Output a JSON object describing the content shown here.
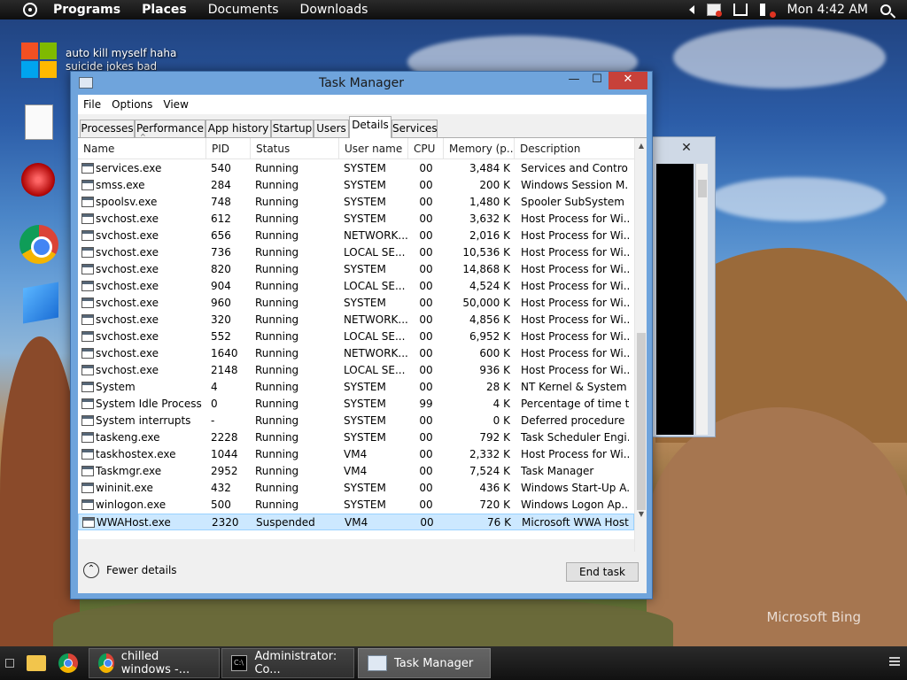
{
  "top_panel": {
    "menus": [
      "Programs",
      "Places",
      "Documents",
      "Downloads"
    ],
    "clock": "Mon 4:42 AM"
  },
  "desktop": {
    "icon_label_1": "auto kill myself haha",
    "icon_label_2": "suicide jokes bad",
    "watermark": "Microsoft Bing"
  },
  "task_manager": {
    "title": "Task Manager",
    "menu": [
      "File",
      "Options",
      "View"
    ],
    "tabs": [
      "Processes",
      "Performance",
      "App history",
      "Startup",
      "Users",
      "Details",
      "Services"
    ],
    "active_tab": "Details",
    "columns": [
      "Name",
      "PID",
      "Status",
      "User name",
      "CPU",
      "Memory (p...",
      "Description"
    ],
    "rows": [
      {
        "name": "services.exe",
        "pid": "540",
        "status": "Running",
        "user": "SYSTEM",
        "cpu": "00",
        "mem": "3,484 K",
        "desc": "Services and Control..."
      },
      {
        "name": "smss.exe",
        "pid": "284",
        "status": "Running",
        "user": "SYSTEM",
        "cpu": "00",
        "mem": "200 K",
        "desc": "Windows Session M..."
      },
      {
        "name": "spoolsv.exe",
        "pid": "748",
        "status": "Running",
        "user": "SYSTEM",
        "cpu": "00",
        "mem": "1,480 K",
        "desc": "Spooler SubSystem ..."
      },
      {
        "name": "svchost.exe",
        "pid": "612",
        "status": "Running",
        "user": "SYSTEM",
        "cpu": "00",
        "mem": "3,632 K",
        "desc": "Host Process for Wi..."
      },
      {
        "name": "svchost.exe",
        "pid": "656",
        "status": "Running",
        "user": "NETWORK...",
        "cpu": "00",
        "mem": "2,016 K",
        "desc": "Host Process for Wi..."
      },
      {
        "name": "svchost.exe",
        "pid": "736",
        "status": "Running",
        "user": "LOCAL SE...",
        "cpu": "00",
        "mem": "10,536 K",
        "desc": "Host Process for Wi..."
      },
      {
        "name": "svchost.exe",
        "pid": "820",
        "status": "Running",
        "user": "SYSTEM",
        "cpu": "00",
        "mem": "14,868 K",
        "desc": "Host Process for Wi..."
      },
      {
        "name": "svchost.exe",
        "pid": "904",
        "status": "Running",
        "user": "LOCAL SE...",
        "cpu": "00",
        "mem": "4,524 K",
        "desc": "Host Process for Wi..."
      },
      {
        "name": "svchost.exe",
        "pid": "960",
        "status": "Running",
        "user": "SYSTEM",
        "cpu": "00",
        "mem": "50,000 K",
        "desc": "Host Process for Wi..."
      },
      {
        "name": "svchost.exe",
        "pid": "320",
        "status": "Running",
        "user": "NETWORK...",
        "cpu": "00",
        "mem": "4,856 K",
        "desc": "Host Process for Wi..."
      },
      {
        "name": "svchost.exe",
        "pid": "552",
        "status": "Running",
        "user": "LOCAL SE...",
        "cpu": "00",
        "mem": "6,952 K",
        "desc": "Host Process for Wi..."
      },
      {
        "name": "svchost.exe",
        "pid": "1640",
        "status": "Running",
        "user": "NETWORK...",
        "cpu": "00",
        "mem": "600 K",
        "desc": "Host Process for Wi..."
      },
      {
        "name": "svchost.exe",
        "pid": "2148",
        "status": "Running",
        "user": "LOCAL SE...",
        "cpu": "00",
        "mem": "936 K",
        "desc": "Host Process for Wi..."
      },
      {
        "name": "System",
        "pid": "4",
        "status": "Running",
        "user": "SYSTEM",
        "cpu": "00",
        "mem": "28 K",
        "desc": "NT Kernel & System"
      },
      {
        "name": "System Idle Process",
        "pid": "0",
        "status": "Running",
        "user": "SYSTEM",
        "cpu": "99",
        "mem": "4 K",
        "desc": "Percentage of time t..."
      },
      {
        "name": "System interrupts",
        "pid": "-",
        "status": "Running",
        "user": "SYSTEM",
        "cpu": "00",
        "mem": "0 K",
        "desc": "Deferred procedure ..."
      },
      {
        "name": "taskeng.exe",
        "pid": "2228",
        "status": "Running",
        "user": "SYSTEM",
        "cpu": "00",
        "mem": "792 K",
        "desc": "Task Scheduler Engi..."
      },
      {
        "name": "taskhostex.exe",
        "pid": "1044",
        "status": "Running",
        "user": "VM4",
        "cpu": "00",
        "mem": "2,332 K",
        "desc": "Host Process for Wi..."
      },
      {
        "name": "Taskmgr.exe",
        "pid": "2952",
        "status": "Running",
        "user": "VM4",
        "cpu": "00",
        "mem": "7,524 K",
        "desc": "Task Manager"
      },
      {
        "name": "wininit.exe",
        "pid": "432",
        "status": "Running",
        "user": "SYSTEM",
        "cpu": "00",
        "mem": "436 K",
        "desc": "Windows Start-Up A..."
      },
      {
        "name": "winlogon.exe",
        "pid": "500",
        "status": "Running",
        "user": "SYSTEM",
        "cpu": "00",
        "mem": "720 K",
        "desc": "Windows Logon Ap..."
      },
      {
        "name": "WWAHost.exe",
        "pid": "2320",
        "status": "Suspended",
        "user": "VM4",
        "cpu": "00",
        "mem": "76 K",
        "desc": "Microsoft WWA Host"
      }
    ],
    "selected_row": 21,
    "fewer_details": "Fewer details",
    "end_task": "End task"
  },
  "taskbar": {
    "items": [
      "chilled windows -...",
      "Administrator: Co...",
      "Task Manager"
    ]
  },
  "colors": {
    "title_bar": "#6fa4dc",
    "close_button": "#c7413a",
    "selection": "#cce8ff"
  }
}
